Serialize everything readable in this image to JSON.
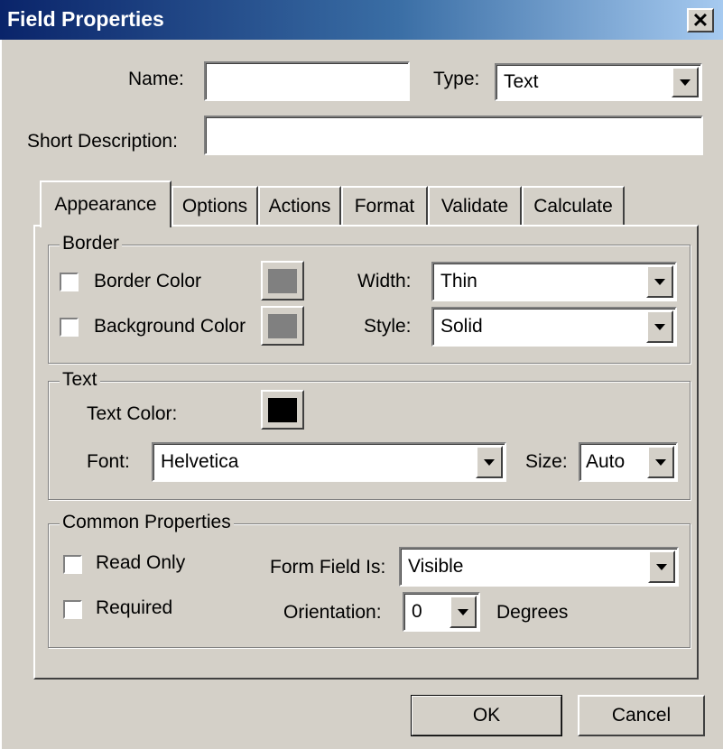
{
  "window": {
    "title": "Field Properties",
    "close_glyph": "✕"
  },
  "form": {
    "name_label": "Name:",
    "name_value": "",
    "type_label": "Type:",
    "type_value": "Text",
    "short_desc_label": "Short Description:",
    "short_desc_value": ""
  },
  "tabs": [
    "Appearance",
    "Options",
    "Actions",
    "Format",
    "Validate",
    "Calculate"
  ],
  "active_tab": "Appearance",
  "border_group": {
    "legend": "Border",
    "border_color_label": "Border Color",
    "border_color_checked": false,
    "border_color_swatch": "#808080",
    "background_color_label": "Background Color",
    "background_color_checked": false,
    "background_color_swatch": "#808080",
    "width_label": "Width:",
    "width_value": "Thin",
    "style_label": "Style:",
    "style_value": "Solid"
  },
  "text_group": {
    "legend": "Text",
    "text_color_label": "Text Color:",
    "text_color_swatch": "#000000",
    "font_label": "Font:",
    "font_value": "Helvetica",
    "size_label": "Size:",
    "size_value": "Auto"
  },
  "common_group": {
    "legend": "Common Properties",
    "read_only_label": "Read Only",
    "read_only_checked": false,
    "required_label": "Required",
    "required_checked": false,
    "form_field_is_label": "Form Field Is:",
    "form_field_is_value": "Visible",
    "orientation_label": "Orientation:",
    "orientation_value": "0",
    "degrees_label": "Degrees"
  },
  "buttons": {
    "ok": "OK",
    "cancel": "Cancel"
  }
}
